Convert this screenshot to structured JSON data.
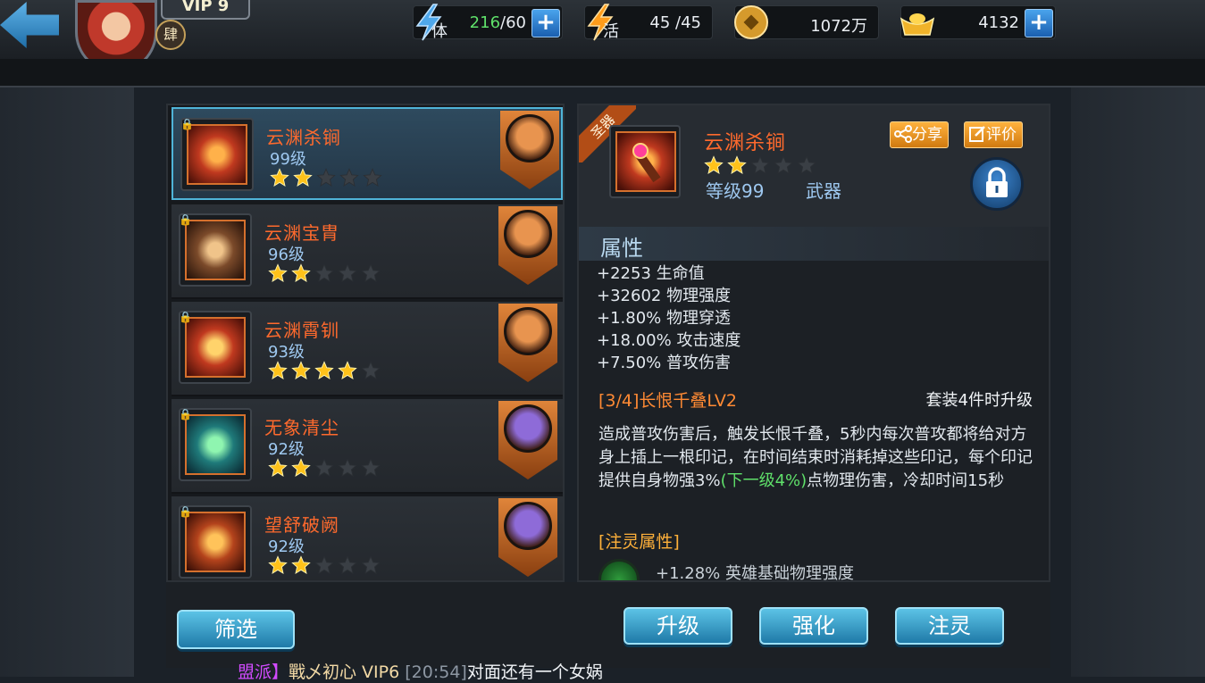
{
  "header": {
    "vip": "VIP 9",
    "rank_char": "肆",
    "stamina": {
      "label": "体",
      "current": "216",
      "max": "/60"
    },
    "vitality": {
      "label": "活",
      "value": "45 /45"
    },
    "coins": {
      "value": "1072万"
    },
    "gold": {
      "value": "4132"
    },
    "plus": "+"
  },
  "equipment_list": [
    {
      "name": "云渊杀锏",
      "level": "99级",
      "stars": 2,
      "selected": true
    },
    {
      "name": "云渊宝胄",
      "level": "96级",
      "stars": 2,
      "selected": false
    },
    {
      "name": "云渊霄钏",
      "level": "93级",
      "stars": 4,
      "selected": false
    },
    {
      "name": "无象清尘",
      "level": "92级",
      "stars": 2,
      "selected": false
    },
    {
      "name": "望舒破阙",
      "level": "92级",
      "stars": 2,
      "selected": false
    }
  ],
  "filter_label": "筛选",
  "detail": {
    "ribbon": "圣器",
    "name": "云渊杀锏",
    "stars": 2,
    "level": "等级99",
    "type": "武器",
    "share_label": "分享",
    "review_label": "评价",
    "attr_title": "属性",
    "attributes": [
      "+2253 生命值",
      "+32602 物理强度",
      "+1.80% 物理穿透",
      "+18.00% 攻击速度",
      "+7.50% 普攻伤害"
    ],
    "set_name": "[3/4]长恨千叠LV2",
    "set_note": "套装4件时升级",
    "set_desc_before": "造成普攻伤害后，触发长恨千叠，5秒内每次普攻都将给对方身上插上一根印记，在时间结束时消耗掉这些印记，每个印记提供自身物强3%",
    "set_desc_green": "(下一级4%)",
    "set_desc_after": "点物理伤害，冷却时间15秒",
    "infuse_title": "[注灵属性]",
    "infuse_line": "+1.28% 英雄基础物理强度"
  },
  "actions": {
    "upgrade": "升级",
    "enhance": "强化",
    "infuse": "注灵"
  },
  "chat": {
    "channel": "盟派】",
    "name": "戰乄初心 VIP6",
    "time": "[20:54]",
    "message": "对面还有一个女娲"
  },
  "colors": {
    "accent_blue": "#4fb4d8",
    "name_orange": "#ff6a2d",
    "star_gold": "#ffc21a",
    "green_text": "#5fe06a"
  }
}
